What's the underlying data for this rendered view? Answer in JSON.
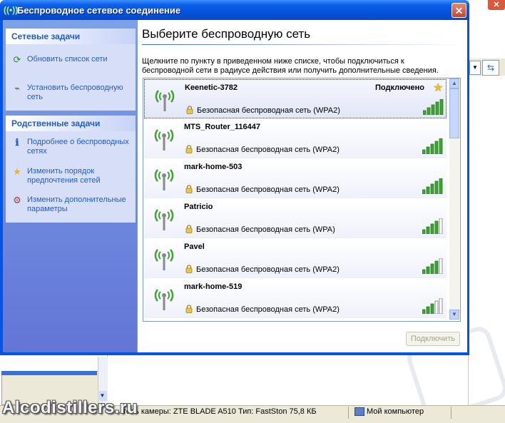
{
  "dialog": {
    "title": "Беспроводное сетевое соединение",
    "close": "✕"
  },
  "sidebar": {
    "network_tasks": {
      "header": "Сетевые задачи",
      "items": [
        {
          "label": "Обновить список сети",
          "icon": "refresh-icon"
        },
        {
          "label": "Установить беспроводную сеть",
          "icon": "wireless-setup-icon"
        }
      ]
    },
    "related_tasks": {
      "header": "Родственные задачи",
      "items": [
        {
          "label": "Подробнее о беспроводных сетях",
          "icon": "info-icon"
        },
        {
          "label": "Изменить порядок предпочтения сетей",
          "icon": "star-icon"
        },
        {
          "label": "Изменить дополнительные параметры",
          "icon": "settings-icon"
        }
      ]
    }
  },
  "main": {
    "heading": "Выберите беспроводную сеть",
    "instructions": "Щелкните по пункту в приведенном ниже списке, чтобы подключиться к беспроводной сети в радиусе действия или получить дополнительные сведения.",
    "networks": [
      {
        "name": "Keenetic-3782",
        "status": "Подключено",
        "security": "Безопасная беспроводная сеть (WPA2)",
        "signal_bars": 5
      },
      {
        "name": "MTS_Router_116447",
        "status": "",
        "security": "Безопасная беспроводная сеть (WPA2)",
        "signal_bars": 5
      },
      {
        "name": "mark-home-503",
        "status": "",
        "security": "Безопасная беспроводная сеть (WPA2)",
        "signal_bars": 5
      },
      {
        "name": "Patricio",
        "status": "",
        "security": "Безопасная беспроводная сеть (WPA)",
        "signal_bars": 4
      },
      {
        "name": "Pavel",
        "status": "",
        "security": "Безопасная беспроводная сеть (WPA2)",
        "signal_bars": 4
      },
      {
        "name": "mark-home-519",
        "status": "",
        "security": "Безопасная беспроводная сеть (WPA2)",
        "signal_bars": 3
      }
    ],
    "connect_button": "Подключить"
  },
  "status_bar": {
    "text": "тель камеры: ZTE BLADE A510 Тип: FastSton 75,8 КБ",
    "computer": "Мой компьютер"
  },
  "watermark": "Alcodistillers.ru",
  "colors": {
    "title_blue": "#0553dd",
    "task_link": "#215dc6",
    "signal_green": "#3fa32f"
  }
}
